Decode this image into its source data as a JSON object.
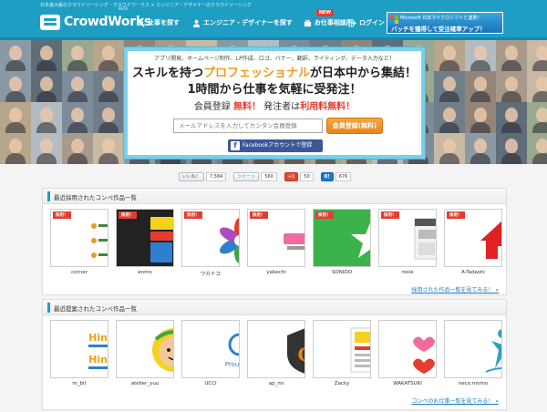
{
  "header": {
    "tagline": "日本最大級のクラウドソーシング・クラウドワークス × エンジニア・デザイナーのクラウドソーシング",
    "logo": "CrowdWorks",
    "logo_beta": "BETA",
    "nav": {
      "search": "仕事を探す",
      "find_engineer": "エンジニア・デザイナーを探す",
      "new_badge": "NEW",
      "consult": "お仕事相談所",
      "login": "ログイン"
    },
    "ms_banner": {
      "line1": "Microsoft 日本マイクロソフトと連携！",
      "line2": "バッチを獲得して受注確率アップ！"
    }
  },
  "hero": {
    "subtitle": "アプリ開発、ホームページ制作、LP作成、ロゴ、バナー、翻訳、ライティング、データ入力など！",
    "headline_pre": "スキルを持つ",
    "headline_accent": "プロフェッショナル",
    "headline_post": "が日本中から集結！",
    "headline2": "1時間から仕事を気軽に受発注！",
    "reg_pre": "会員登録 ",
    "reg_free1": "無料！",
    "reg_mid": " 発注者は",
    "reg_free2": "利用料無料！",
    "email_placeholder": "メールアドレスを入力してカンタン会員登録",
    "register_button": "会員登録(無料)",
    "facebook_button": "Facebookアカウントで登録"
  },
  "social": {
    "fb_label": "いいね！",
    "fb_count": "7,584",
    "tw_label": "ツイート",
    "tw_count": "560",
    "gp_label": "+1",
    "gp_count": "50",
    "hb_label": "B!",
    "hb_count": "676"
  },
  "adopted": {
    "title": "最近採用されたコンペ作品一覧",
    "ribbon": "採用！",
    "items": [
      {
        "name": "corner"
      },
      {
        "name": "enmo"
      },
      {
        "name": "ワカナコ"
      },
      {
        "name": "yabechi"
      },
      {
        "name": "SONIDO"
      },
      {
        "name": "rosie"
      },
      {
        "name": "A-Tadashi"
      }
    ],
    "more": "採用された作品一覧を見てみる！ »"
  },
  "proposed": {
    "title": "最近提案されたコンペ作品一覧",
    "items": [
      {
        "name": "m_bit",
        "art_text": "Hinode"
      },
      {
        "name": "atelier_yuu"
      },
      {
        "name": "UCCI",
        "art_text": "Proud Inc"
      },
      {
        "name": "ap_mi",
        "art_text": "G"
      },
      {
        "name": "Zacky"
      },
      {
        "name": "WAKATSUKI"
      },
      {
        "name": "neco.momo"
      }
    ],
    "more": "コンペのお仕事一覧を見てみる！ »"
  },
  "colors": {
    "brand": "#1f9ec4",
    "accent": "#f39a1e",
    "red": "#e63c2f"
  }
}
